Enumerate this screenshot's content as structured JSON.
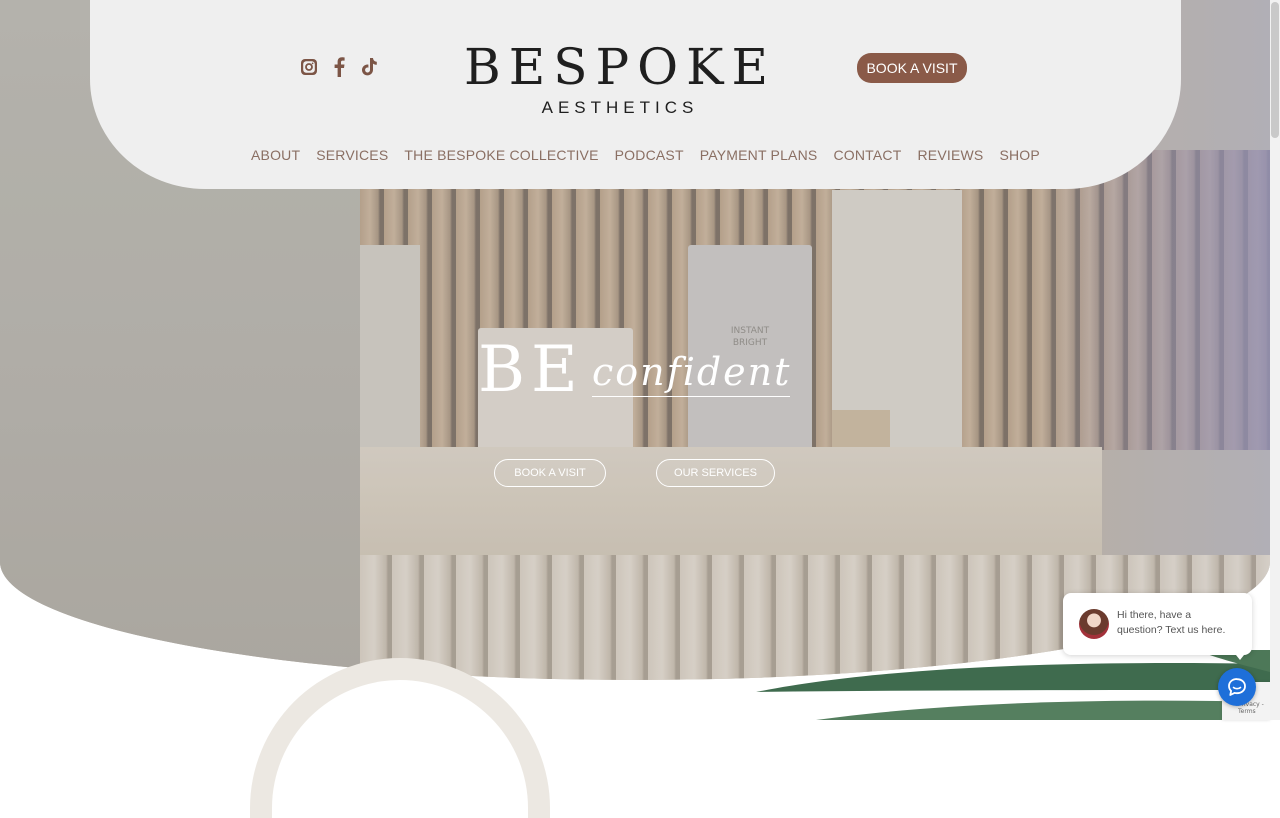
{
  "header": {
    "brand_name": "BESPOKE",
    "brand_sub": "AESTHETICS",
    "book_label": "BOOK A VISIT",
    "socials": [
      {
        "icon": "instagram-icon"
      },
      {
        "icon": "facebook-icon"
      },
      {
        "icon": "tiktok-icon"
      }
    ],
    "nav": [
      "ABOUT",
      "SERVICES",
      "THE BESPOKE COLLECTIVE",
      "PODCAST",
      "PAYMENT PLANS",
      "CONTACT",
      "REVIEWS",
      "SHOP"
    ]
  },
  "hero": {
    "tagline_be": "BE",
    "tagline_script": "confident",
    "product_label_line1": "INSTANT",
    "product_label_line2": "BRIGHT",
    "book_label": "BOOK A VISIT",
    "services_label": "OUR SERVICES"
  },
  "chat": {
    "message": "Hi there, have a question? Text us here.",
    "launcher_icon": "chat-icon"
  },
  "recaptcha": {
    "text": "Privacy - Terms"
  },
  "colors": {
    "accent": "#8a5a48",
    "nav_text": "#8a6f63",
    "header_bg": "#efefef",
    "chat_blue": "#1e6fd9"
  }
}
